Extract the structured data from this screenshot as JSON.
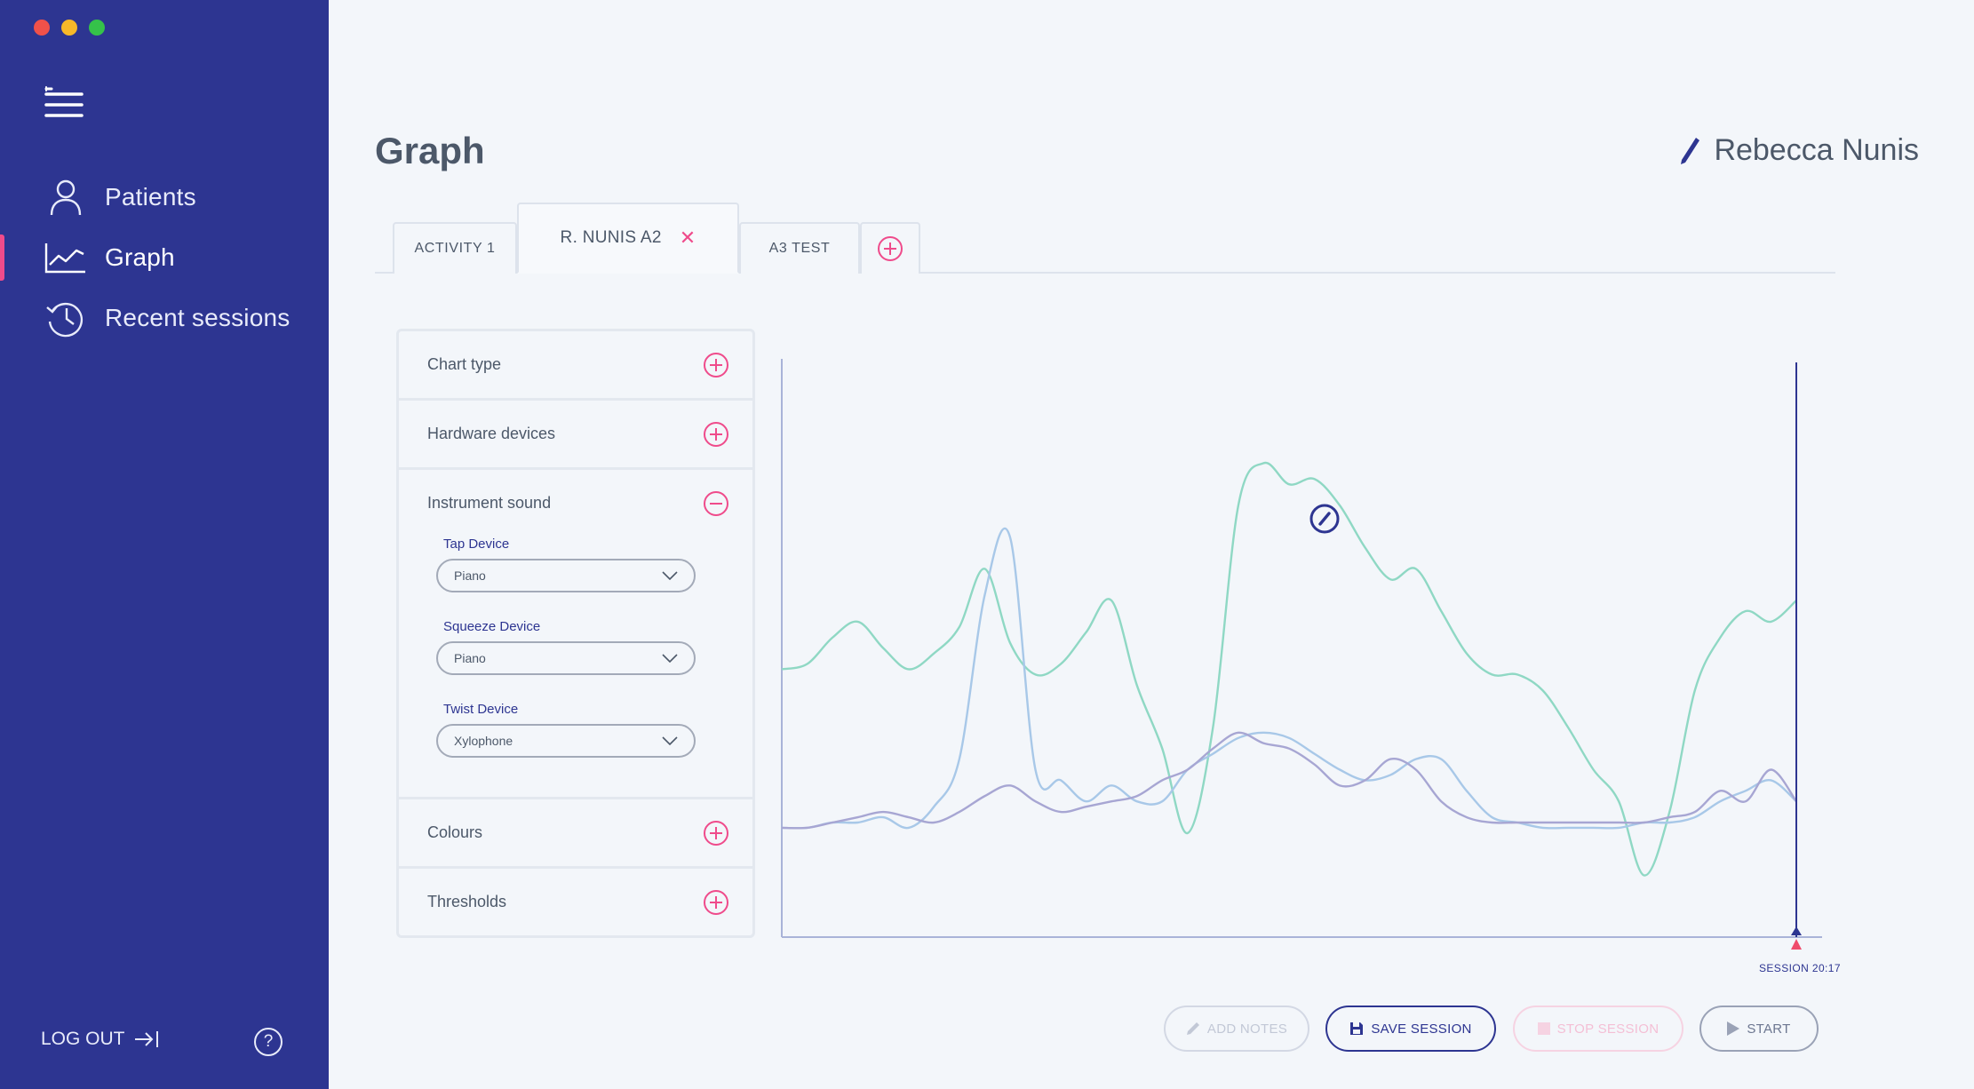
{
  "sidebar": {
    "items": [
      {
        "label": "Patients",
        "icon": "person-icon",
        "active": false
      },
      {
        "label": "Graph",
        "icon": "chart-icon",
        "active": true
      },
      {
        "label": "Recent sessions",
        "icon": "history-icon",
        "active": false
      }
    ],
    "logout_label": "LOG OUT",
    "help_label": "?",
    "colors": {
      "background": "#2d3591",
      "accent": "#ef4b8b"
    }
  },
  "header": {
    "title": "Graph",
    "user_name": "Rebecca Nunis"
  },
  "tabs": [
    {
      "label": "ACTIVITY 1",
      "active": false
    },
    {
      "label": "R. NUNIS A2",
      "active": true,
      "closable": true
    },
    {
      "label": "A3 TEST",
      "active": false
    }
  ],
  "settings": {
    "chart_type": "Chart type",
    "hardware_devices": "Hardware devices",
    "instrument_sound": "Instrument sound",
    "colours": "Colours",
    "thresholds": "Thresholds",
    "devices": [
      {
        "label": "Tap Device",
        "value": "Piano"
      },
      {
        "label": "Squeeze Device",
        "value": "Piano"
      },
      {
        "label": "Twist Device",
        "value": "Xylophone"
      }
    ]
  },
  "chart_data": {
    "type": "line",
    "title": "",
    "xlabel": "",
    "ylabel": "",
    "grid": false,
    "x": [
      0,
      1,
      2,
      3,
      4,
      5,
      6,
      7,
      8,
      9,
      10,
      11,
      12,
      13,
      14,
      15,
      16,
      17,
      18,
      19,
      20,
      21,
      22,
      23,
      24,
      25,
      26,
      27,
      28,
      29,
      30,
      31,
      32,
      33,
      34,
      35,
      36,
      37,
      38,
      39,
      40
    ],
    "series": [
      {
        "values": [
          49,
          50,
          55,
          58,
          53,
          49,
          52,
          57,
          68,
          54,
          48,
          50,
          56,
          62,
          46,
          34,
          18,
          38,
          80,
          88,
          84,
          85,
          80,
          72,
          66,
          68,
          60,
          52,
          48,
          48,
          45,
          38,
          30,
          24,
          10,
          22,
          45,
          55,
          60,
          58,
          62
        ],
        "color": "#8fd8c4"
      },
      {
        "values": [
          19,
          19,
          20,
          20,
          21,
          19,
          23,
          32,
          63,
          74,
          30,
          28,
          24,
          27,
          24,
          24,
          30,
          33,
          36,
          37,
          36,
          33,
          30,
          28,
          29,
          32,
          32,
          26,
          21,
          20,
          19,
          19,
          19,
          19,
          20,
          20,
          21,
          24,
          26,
          28,
          24
        ],
        "color": "#a8c8e8"
      },
      {
        "values": [
          19,
          19,
          20,
          21,
          22,
          21,
          20,
          22,
          25,
          27,
          24,
          22,
          23,
          24,
          25,
          28,
          30,
          34,
          37,
          35,
          34,
          31,
          27,
          28,
          32,
          30,
          24,
          21,
          20,
          20,
          20,
          20,
          20,
          20,
          20,
          21,
          22,
          26,
          24,
          30,
          24
        ],
        "color": "#a7a6d3"
      }
    ],
    "marker_label": "SESSION 20:17",
    "colors": {
      "axis": "#a9b3d8",
      "cursor": "#2d3591",
      "marker": "#ef4b6b"
    }
  },
  "actions": {
    "add_notes": "ADD NOTES",
    "save_session": "SAVE SESSION",
    "stop_session": "STOP SESSION",
    "start": "START"
  }
}
